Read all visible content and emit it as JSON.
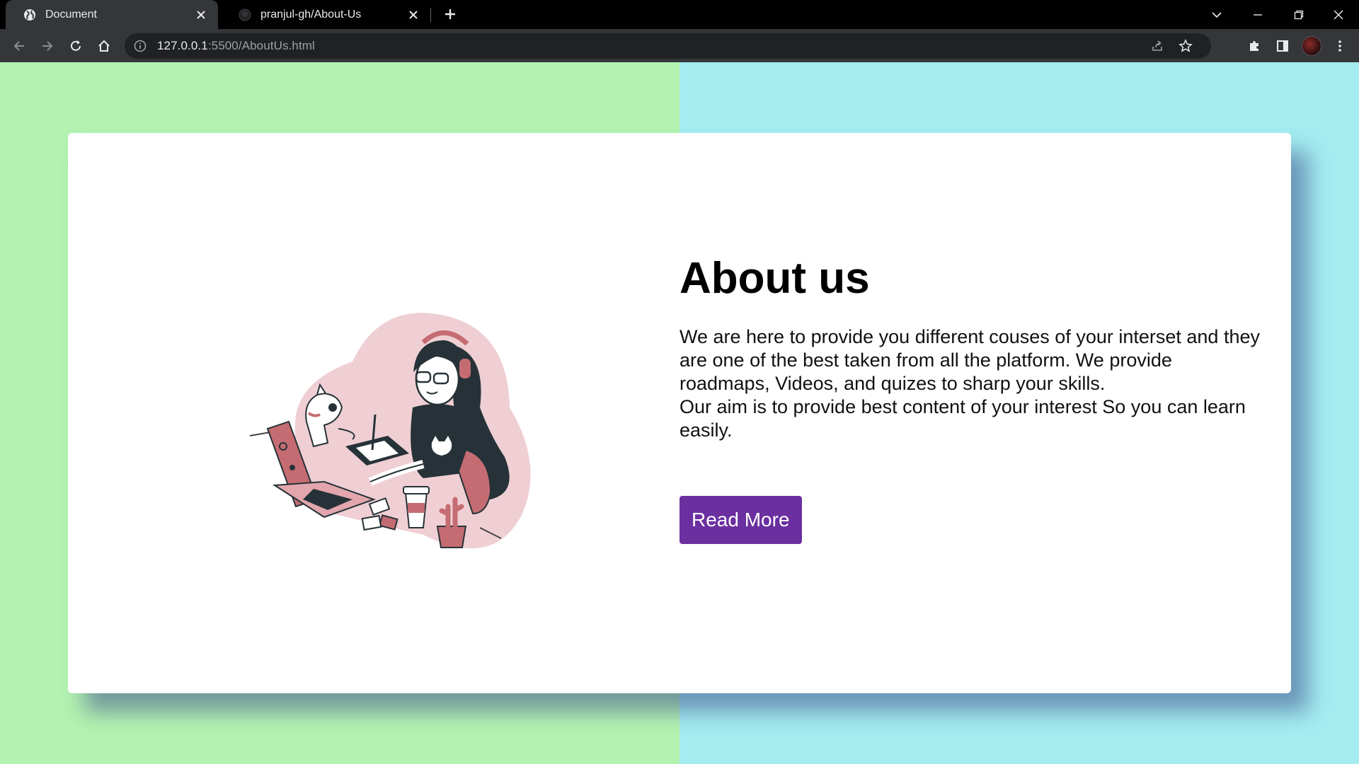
{
  "browser": {
    "tabs": [
      {
        "title": "Document",
        "active": true
      },
      {
        "title": "pranjul-gh/About-Us",
        "active": false
      }
    ],
    "url": {
      "host": "127.0.0.1",
      "rest": ":5500/AboutUs.html"
    }
  },
  "page": {
    "heading": "About us",
    "paragraph1": "We are here to provide you different couses of your interset and they are one of the best taken from all the platform. We provide roadmaps, Videos, and quizes to sharp your skills.",
    "paragraph2": "Our aim is to provide best content of your interest So you can learn easily.",
    "button_label": "Read More",
    "colors": {
      "bg_left": "#b3f2b0",
      "bg_right": "#a4ecf0",
      "button": "#6b2fa0",
      "illustration_accent": "#c46c72",
      "illustration_blob": "#efcfd4"
    }
  }
}
